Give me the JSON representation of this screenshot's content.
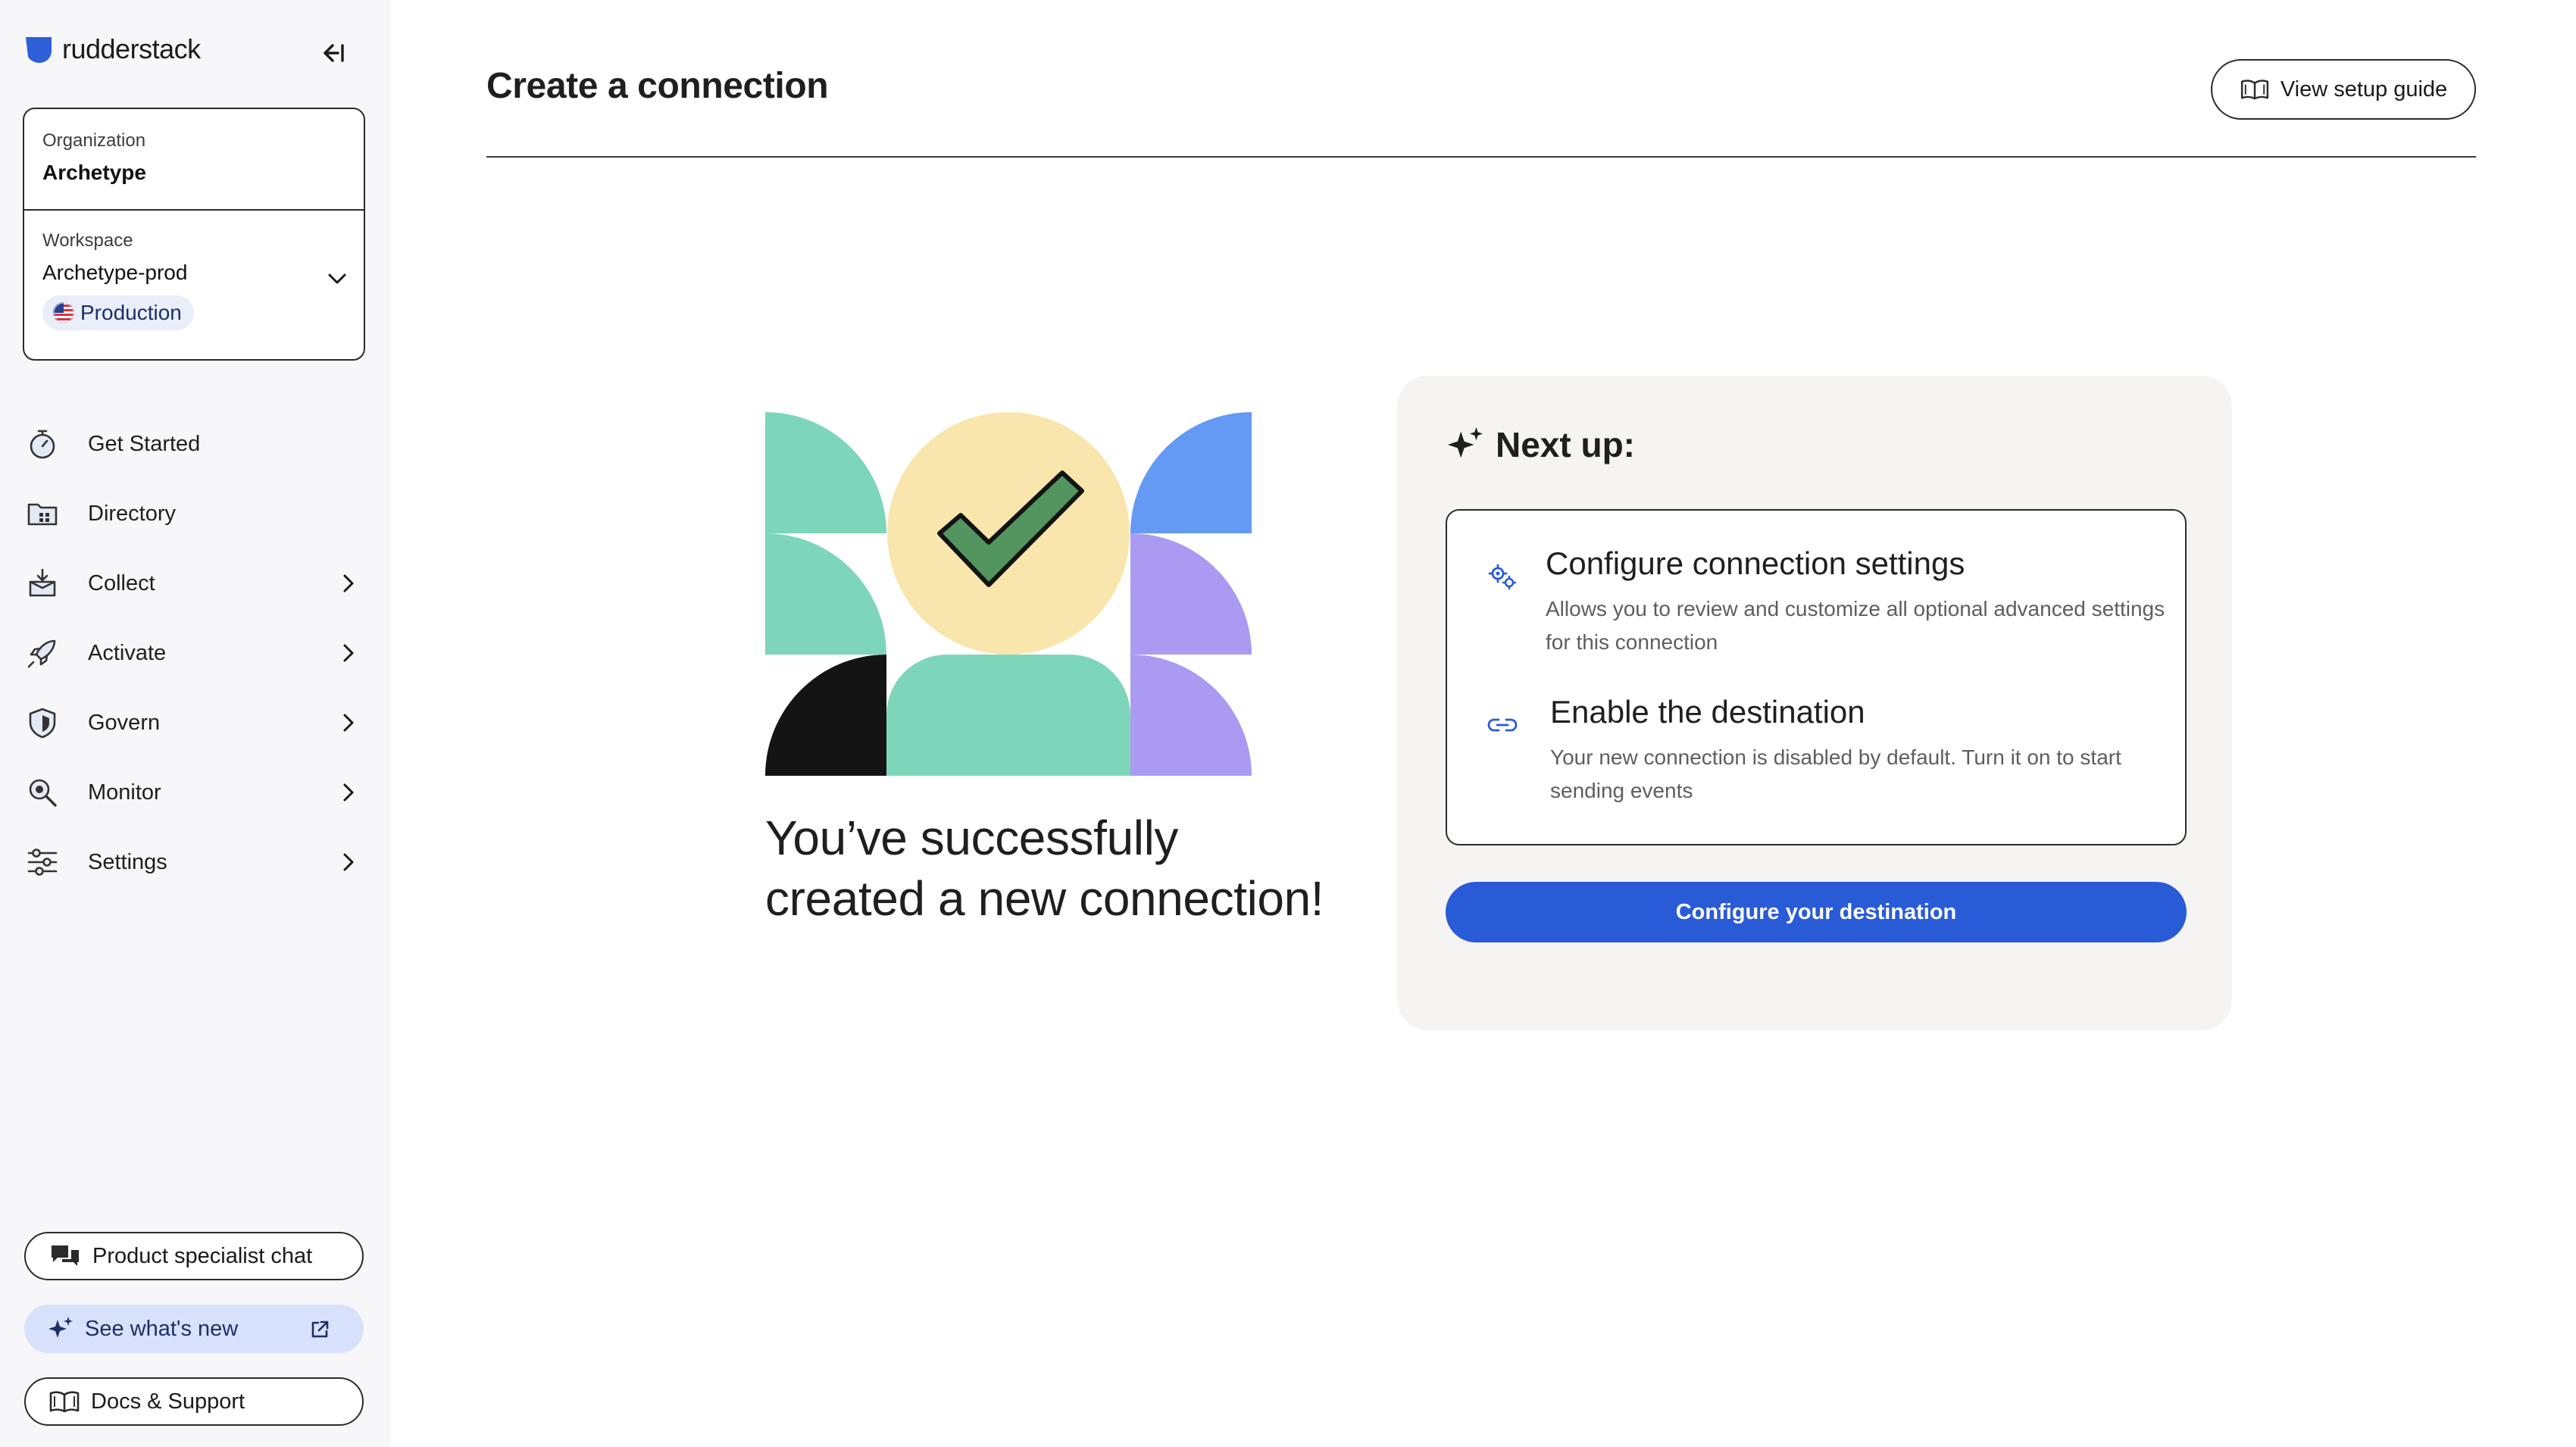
{
  "sidebar": {
    "logo_text": "rudderstack",
    "organization": {
      "label": "Organization",
      "name": "Archetype"
    },
    "workspace": {
      "label": "Workspace",
      "name": "Archetype-prod",
      "environment": "Production"
    },
    "nav": [
      {
        "label": "Get Started",
        "icon": "stopwatch-icon"
      },
      {
        "label": "Directory",
        "icon": "folder-icon"
      },
      {
        "label": "Collect",
        "icon": "inbox-icon"
      },
      {
        "label": "Activate",
        "icon": "rocket-icon"
      },
      {
        "label": "Govern",
        "icon": "shield-icon"
      },
      {
        "label": "Monitor",
        "icon": "magnifier-icon"
      },
      {
        "label": "Settings",
        "icon": "sliders-icon"
      }
    ],
    "specialist_chat": "Product specialist chat",
    "whats_new": "See what's new",
    "docs_support": "Docs & Support"
  },
  "header": {
    "title": "Create a connection",
    "guide_button": "View setup guide"
  },
  "main": {
    "success_line1": "You’ve successfully",
    "success_line2": "created a new connection!",
    "next_up": {
      "heading": "Next up:",
      "tasks": [
        {
          "title": "Configure connection settings",
          "description": "Allows you to review and customize all optional advanced settings for this connection"
        },
        {
          "title": "Enable the destination",
          "description": "Your new connection is disabled by default. Turn it on to start sending events"
        }
      ],
      "cta": "Configure your destination"
    }
  },
  "colors": {
    "primary": "#2a5bd7",
    "teal": "#7dd6b9",
    "yellow": "#f9e6ac",
    "blue": "#6499f4",
    "purple": "#ab9af2",
    "check_green": "#53955f",
    "dark": "#141414",
    "panel_bg": "#f5f4f2",
    "sidebar_bg": "#f7f7f9"
  }
}
